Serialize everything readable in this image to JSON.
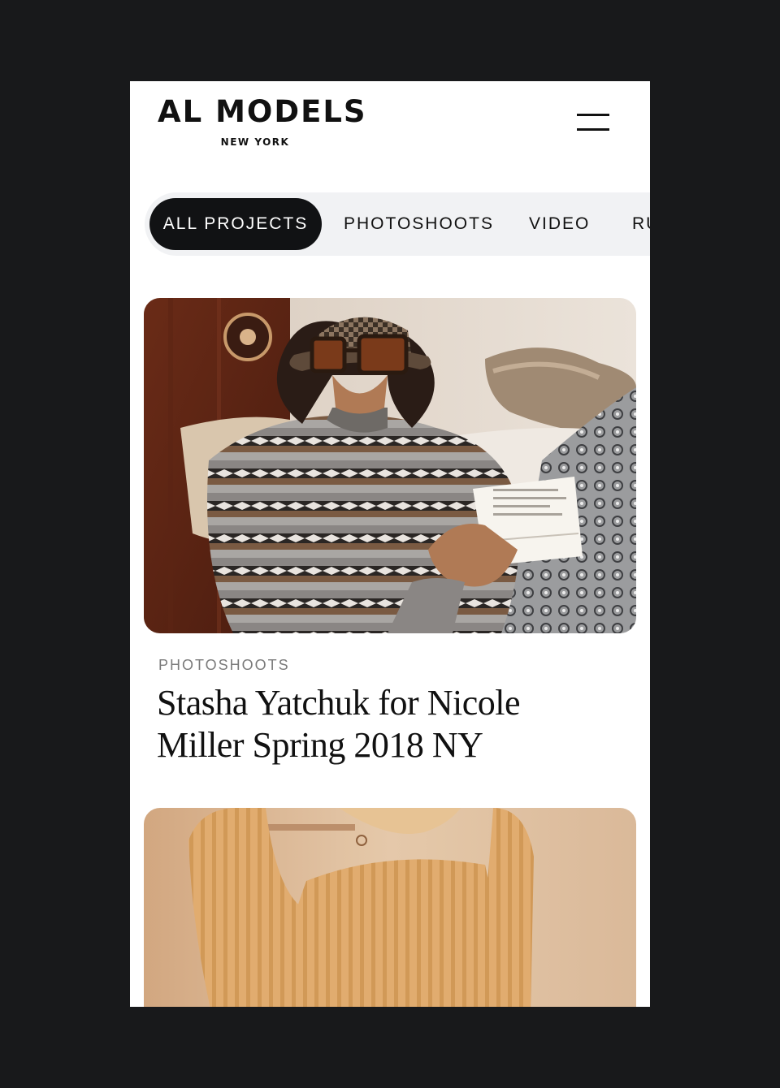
{
  "brand": {
    "name": "AL MODELS",
    "location": "NEW YORK"
  },
  "filters": [
    {
      "label": "ALL PROJECTS",
      "active": true
    },
    {
      "label": "PHOTOSHOOTS",
      "active": false
    },
    {
      "label": "VIDEO",
      "active": false
    },
    {
      "label": "RU",
      "active": false
    }
  ],
  "projects": [
    {
      "category": "PHOTOSHOOTS",
      "title": "Stasha Yatchuk for Nicole Miller Spring 2018 NY",
      "image": "model-in-knit-sweater-photo"
    },
    {
      "image": "model-in-peach-sweater-photo"
    }
  ],
  "colors": {
    "background": "#18191b",
    "page": "#ffffff",
    "active_pill": "#111214",
    "filter_bar": "#f1f2f4",
    "category_text": "#7a7a7a"
  }
}
